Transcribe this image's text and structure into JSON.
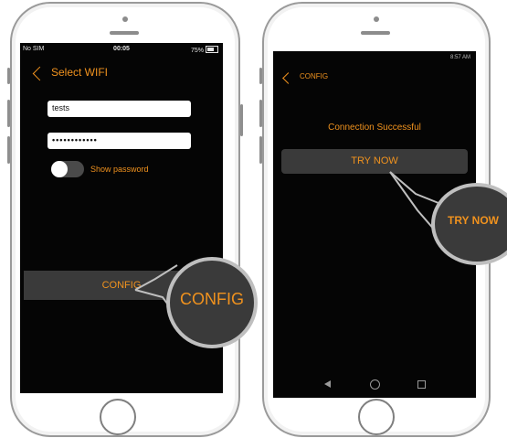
{
  "left_phone": {
    "status": {
      "carrier": "No SIM",
      "time": "00:05",
      "battery": "75%"
    },
    "header_title": "Select WIFI",
    "ssid_value": "tests",
    "password_value": "••••••••••••",
    "toggle_label": "Show password",
    "config_button_label": "CONFIG",
    "callout_label": "CONFIG"
  },
  "right_phone": {
    "status": {
      "time": "8:57 AM"
    },
    "header_title": "CONFIG",
    "message": "Connection Successful",
    "try_button_label": "TRY NOW",
    "callout_label": "TRY NOW"
  },
  "colors": {
    "accent": "#f0921e",
    "screen": "#050505",
    "button": "#3a3a3a"
  },
  "icons": [
    "back-chevron-icon",
    "battery-icon",
    "nav-back-icon",
    "nav-home-icon",
    "nav-recent-icon"
  ]
}
